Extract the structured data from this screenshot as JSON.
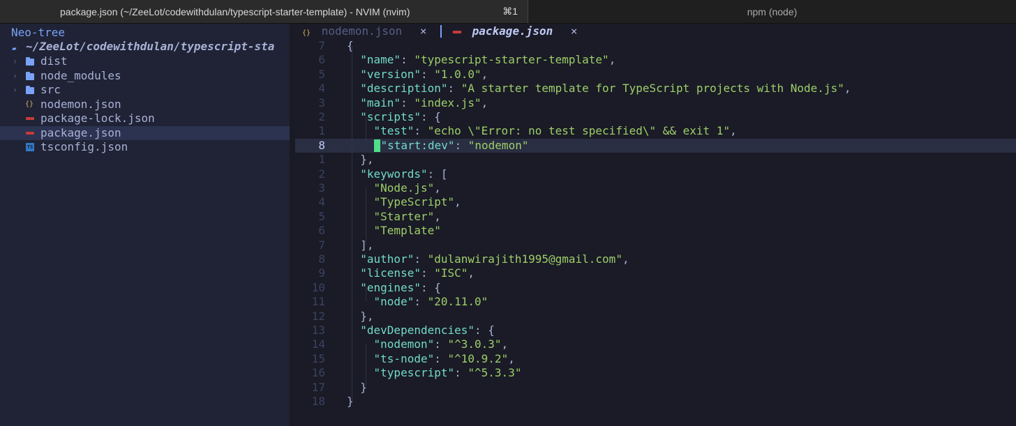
{
  "window": {
    "active_tab_title": "package.json (~/ZeeLot/codewithdulan/typescript-starter-template) - NVIM (nvim)",
    "active_tab_shortcut": "⌘1",
    "inactive_tab_title": "npm (node)"
  },
  "neotree": {
    "header": "Neo-tree",
    "root": "~/ZeeLot/codewithdulan/typescript-sta",
    "items": [
      {
        "label": "dist",
        "icon": "folder-icon",
        "chevron": "›"
      },
      {
        "label": "node_modules",
        "icon": "folder-icon",
        "chevron": "›"
      },
      {
        "label": "src",
        "icon": "folder-icon",
        "chevron": "›"
      },
      {
        "label": "nodemon.json",
        "icon": "json-icon",
        "glyph": "{}"
      },
      {
        "label": "package-lock.json",
        "icon": "npm-icon"
      },
      {
        "label": "package.json",
        "icon": "npm-icon"
      },
      {
        "label": "tsconfig.json",
        "icon": "typescript-icon",
        "glyph": "TS"
      }
    ]
  },
  "buffers": [
    {
      "name": "nodemon.json",
      "icon_glyph": "{}",
      "close": "×"
    },
    {
      "name": "package.json",
      "close": "×"
    }
  ],
  "editor": {
    "lines": [
      {
        "num": "7",
        "code": [
          [
            "p",
            "{"
          ]
        ]
      },
      {
        "num": "6",
        "code": [
          [
            "p",
            "  "
          ],
          [
            "k",
            "\"name\""
          ],
          [
            "p",
            ": "
          ],
          [
            "s",
            "\"typescript-starter-template\""
          ],
          [
            "p",
            ","
          ]
        ]
      },
      {
        "num": "5",
        "code": [
          [
            "p",
            "  "
          ],
          [
            "k",
            "\"version\""
          ],
          [
            "p",
            ": "
          ],
          [
            "s",
            "\"1.0.0\""
          ],
          [
            "p",
            ","
          ]
        ]
      },
      {
        "num": "4",
        "code": [
          [
            "p",
            "  "
          ],
          [
            "k",
            "\"description\""
          ],
          [
            "p",
            ": "
          ],
          [
            "s",
            "\"A starter template for TypeScript projects with Node.js\""
          ],
          [
            "p",
            ","
          ]
        ]
      },
      {
        "num": "3",
        "code": [
          [
            "p",
            "  "
          ],
          [
            "k",
            "\"main\""
          ],
          [
            "p",
            ": "
          ],
          [
            "s",
            "\"index.js\""
          ],
          [
            "p",
            ","
          ]
        ]
      },
      {
        "num": "2",
        "code": [
          [
            "p",
            "  "
          ],
          [
            "k",
            "\"scripts\""
          ],
          [
            "p",
            ": {"
          ]
        ]
      },
      {
        "num": "1",
        "code": [
          [
            "p",
            "    "
          ],
          [
            "k",
            "\"test\""
          ],
          [
            "p",
            ": "
          ],
          [
            "s",
            "\"echo \\\"Error: no test specified\\\" && exit 1\""
          ],
          [
            "p",
            ","
          ]
        ]
      },
      {
        "num": "8",
        "code": [
          [
            "k",
            "\"start:dev\""
          ],
          [
            "p",
            ": "
          ],
          [
            "s",
            "\"nodemon\""
          ]
        ]
      },
      {
        "num": "1",
        "code": [
          [
            "p",
            "  },"
          ]
        ]
      },
      {
        "num": "2",
        "code": [
          [
            "p",
            "  "
          ],
          [
            "k",
            "\"keywords\""
          ],
          [
            "p",
            ": ["
          ]
        ]
      },
      {
        "num": "3",
        "code": [
          [
            "p",
            "    "
          ],
          [
            "s",
            "\"Node.js\""
          ],
          [
            "p",
            ","
          ]
        ]
      },
      {
        "num": "4",
        "code": [
          [
            "p",
            "    "
          ],
          [
            "s",
            "\"TypeScript\""
          ],
          [
            "p",
            ","
          ]
        ]
      },
      {
        "num": "5",
        "code": [
          [
            "p",
            "    "
          ],
          [
            "s",
            "\"Starter\""
          ],
          [
            "p",
            ","
          ]
        ]
      },
      {
        "num": "6",
        "code": [
          [
            "p",
            "    "
          ],
          [
            "s",
            "\"Template\""
          ]
        ]
      },
      {
        "num": "7",
        "code": [
          [
            "p",
            "  ],"
          ]
        ]
      },
      {
        "num": "8",
        "code": [
          [
            "p",
            "  "
          ],
          [
            "k",
            "\"author\""
          ],
          [
            "p",
            ": "
          ],
          [
            "s",
            "\"dulanwirajith1995@gmail.com\""
          ],
          [
            "p",
            ","
          ]
        ]
      },
      {
        "num": "9",
        "code": [
          [
            "p",
            "  "
          ],
          [
            "k",
            "\"license\""
          ],
          [
            "p",
            ": "
          ],
          [
            "s",
            "\"ISC\""
          ],
          [
            "p",
            ","
          ]
        ]
      },
      {
        "num": "10",
        "code": [
          [
            "p",
            "  "
          ],
          [
            "k",
            "\"engines\""
          ],
          [
            "p",
            ": {"
          ]
        ]
      },
      {
        "num": "11",
        "code": [
          [
            "p",
            "    "
          ],
          [
            "k",
            "\"node\""
          ],
          [
            "p",
            ": "
          ],
          [
            "s",
            "\"20.11.0\""
          ]
        ]
      },
      {
        "num": "12",
        "code": [
          [
            "p",
            "  },"
          ]
        ]
      },
      {
        "num": "13",
        "code": [
          [
            "p",
            "  "
          ],
          [
            "k",
            "\"devDependencies\""
          ],
          [
            "p",
            ": {"
          ]
        ]
      },
      {
        "num": "14",
        "code": [
          [
            "p",
            "    "
          ],
          [
            "k",
            "\"nodemon\""
          ],
          [
            "p",
            ": "
          ],
          [
            "s",
            "\"^3.0.3\""
          ],
          [
            "p",
            ","
          ]
        ]
      },
      {
        "num": "15",
        "code": [
          [
            "p",
            "    "
          ],
          [
            "k",
            "\"ts-node\""
          ],
          [
            "p",
            ": "
          ],
          [
            "s",
            "\"^10.9.2\""
          ],
          [
            "p",
            ","
          ]
        ]
      },
      {
        "num": "16",
        "code": [
          [
            "p",
            "    "
          ],
          [
            "k",
            "\"typescript\""
          ],
          [
            "p",
            ": "
          ],
          [
            "s",
            "\"^5.3.3\""
          ]
        ]
      },
      {
        "num": "17",
        "code": [
          [
            "p",
            "  }"
          ]
        ]
      },
      {
        "num": "18",
        "code": [
          [
            "p",
            "}"
          ]
        ]
      }
    ]
  },
  "colors": {
    "background": "#1a1b26",
    "sidebar": "#1f2335",
    "key": "#73daca",
    "string": "#9ece6a",
    "cursor": "#4fe089"
  }
}
